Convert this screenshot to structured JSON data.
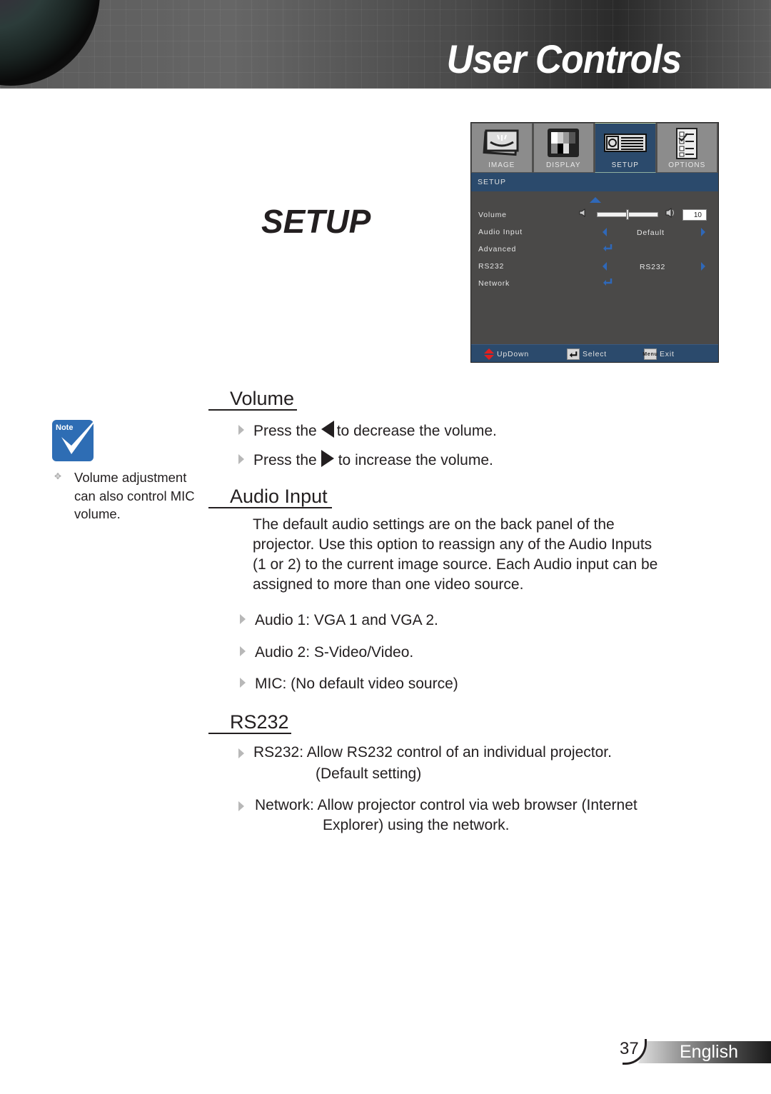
{
  "header": {
    "title": "User Controls"
  },
  "section_title": "SETUP",
  "osd": {
    "tabs": [
      {
        "label": "IMAGE",
        "icon": "image-icon",
        "active": false
      },
      {
        "label": "DISPLAY",
        "icon": "display-icon",
        "active": false
      },
      {
        "label": "SETUP",
        "icon": "projector-icon",
        "active": true
      },
      {
        "label": "OPTIONS",
        "icon": "options-checklist-icon",
        "active": false
      }
    ],
    "menu_title": "SETUP",
    "rows": [
      {
        "label": "Volume",
        "type": "slider",
        "value": "10",
        "level_fraction": 0.5
      },
      {
        "label": "Audio Input",
        "type": "select",
        "value": "Default"
      },
      {
        "label": "Advanced",
        "type": "submenu"
      },
      {
        "label": "RS232",
        "type": "select",
        "value": "RS232"
      },
      {
        "label": "Network",
        "type": "submenu"
      }
    ],
    "footer": {
      "updown": "UpDown",
      "select": "Select",
      "menu_key": "Menu",
      "exit": "Exit"
    }
  },
  "note": {
    "badge": "Note",
    "text_lines": [
      "Volume adjustment",
      "can also control MIC",
      "volume."
    ]
  },
  "sections": {
    "volume": {
      "heading": "Volume",
      "items": [
        {
          "pre": "Press the",
          "post": "to decrease the volume."
        },
        {
          "pre": "Press the",
          "post": "to increase the volume."
        }
      ]
    },
    "audio_input": {
      "heading": "Audio Input",
      "paragraph_lines": [
        "The default audio settings are on the back panel of the",
        "projector. Use this option to reassign any of the Audio Inputs",
        "(1 or 2) to the current image source. Each Audio input can be",
        "assigned to more than one video source."
      ],
      "items": [
        "Audio 1: VGA 1 and VGA 2.",
        "Audio 2: S-Video/Video.",
        "MIC: (No default video source)"
      ]
    },
    "rs232": {
      "heading": "RS232",
      "items": [
        {
          "line1": "RS232: Allow RS232 control of an individual projector.",
          "line2": "(Default setting)"
        },
        {
          "line1": "Network: Allow projector control via web browser (Internet",
          "line2": "Explorer) using the network."
        }
      ]
    }
  },
  "footer": {
    "page_number": "37",
    "language": "English"
  }
}
